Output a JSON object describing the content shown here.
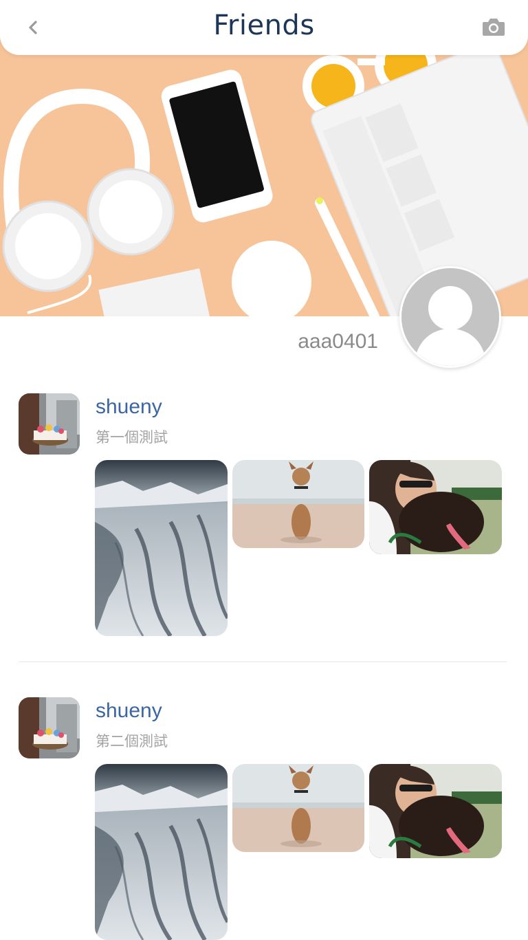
{
  "header": {
    "title": "Friends",
    "back_icon": "chevron-left-icon",
    "camera_icon": "camera-icon"
  },
  "profile": {
    "username": "aaa0401",
    "avatar_icon": "user-silhouette-icon"
  },
  "posts": [
    {
      "author": "shueny",
      "text": "第一個測試",
      "photos": [
        "snowy-glacier-photo",
        "dog-on-beach-photo",
        "woman-hugging-dog-photo"
      ]
    },
    {
      "author": "shueny",
      "text": "第二個測試",
      "photos": [
        "snowy-glacier-photo",
        "dog-on-beach-photo",
        "woman-hugging-dog-photo"
      ]
    }
  ],
  "colors": {
    "title": "#1d3557",
    "author": "#3b66a3",
    "subtext": "#a3a3a3",
    "cover_bg": "#f6c295"
  }
}
